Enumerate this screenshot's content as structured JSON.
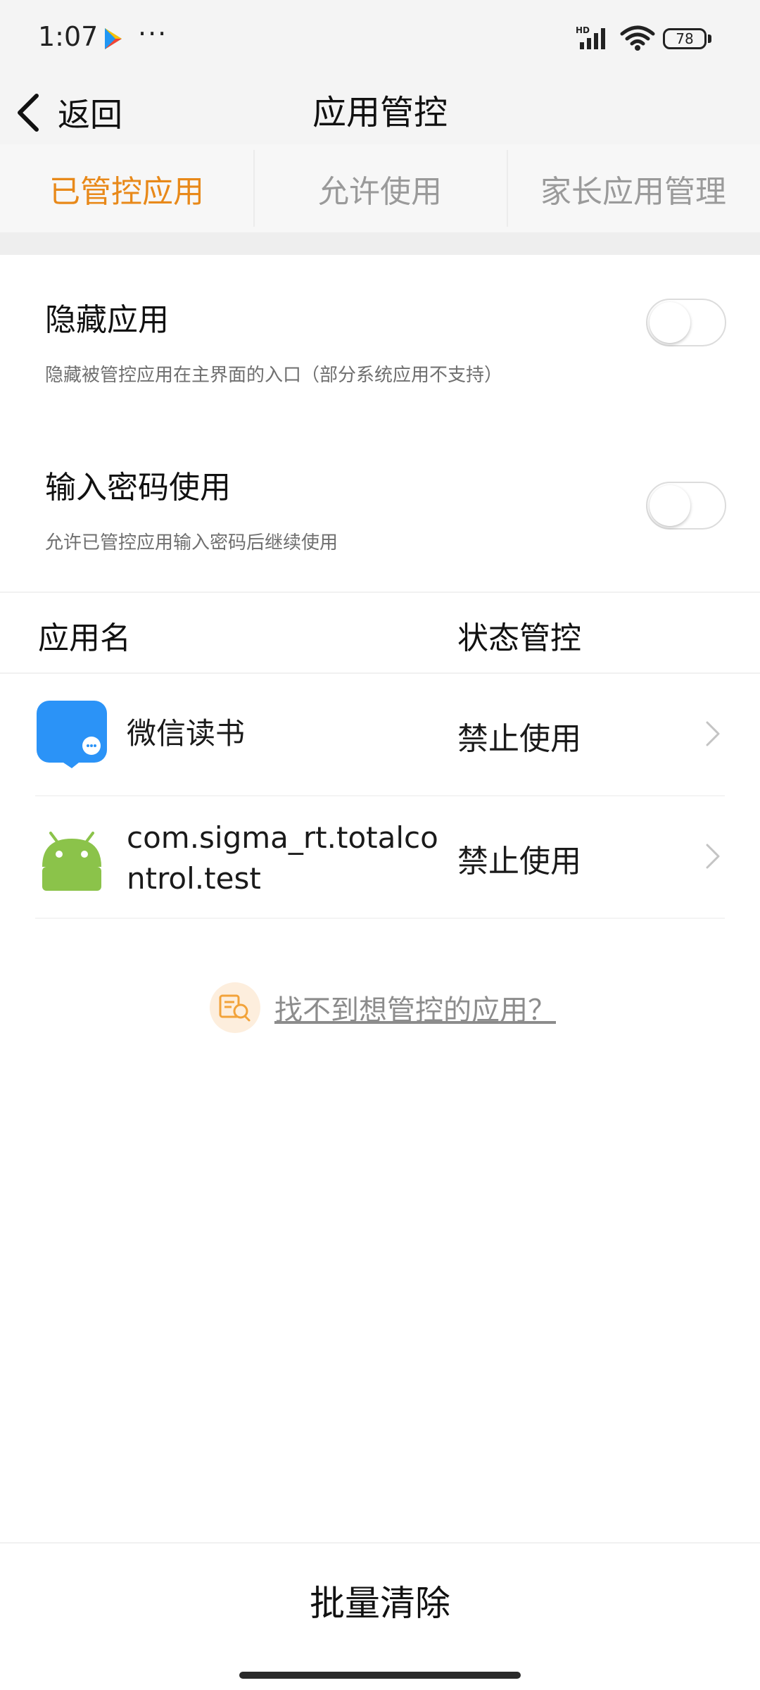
{
  "status_bar": {
    "time": "1:07",
    "more": "···",
    "battery": "78",
    "icons": [
      "play-store-icon",
      "signal-icon",
      "wifi-icon",
      "battery-icon"
    ]
  },
  "header": {
    "back_label": "返回",
    "title": "应用管控"
  },
  "tabs": [
    {
      "label": "已管控应用",
      "active": true
    },
    {
      "label": "允许使用",
      "active": false
    },
    {
      "label": "家长应用管理",
      "active": false
    }
  ],
  "settings": [
    {
      "title": "隐藏应用",
      "desc": "隐藏被管控应用在主界面的入口（部分系统应用不支持）",
      "enabled": false
    },
    {
      "title": "输入密码使用",
      "desc": "允许已管控应用输入密码后继续使用",
      "enabled": false
    }
  ],
  "list_header": {
    "name": "应用名",
    "status": "状态管控"
  },
  "apps": [
    {
      "name": "微信读书",
      "status": "禁止使用",
      "icon": "weread-icon"
    },
    {
      "name": "com.sigma_rt.totalcontrol.test",
      "status": "禁止使用",
      "icon": "android-icon"
    }
  ],
  "help_link": "找不到想管控的应用？",
  "bottom_button": "批量清除",
  "colors": {
    "accent": "#e8891a",
    "weread_blue": "#2b93f7",
    "android_green": "#8bc34a"
  }
}
